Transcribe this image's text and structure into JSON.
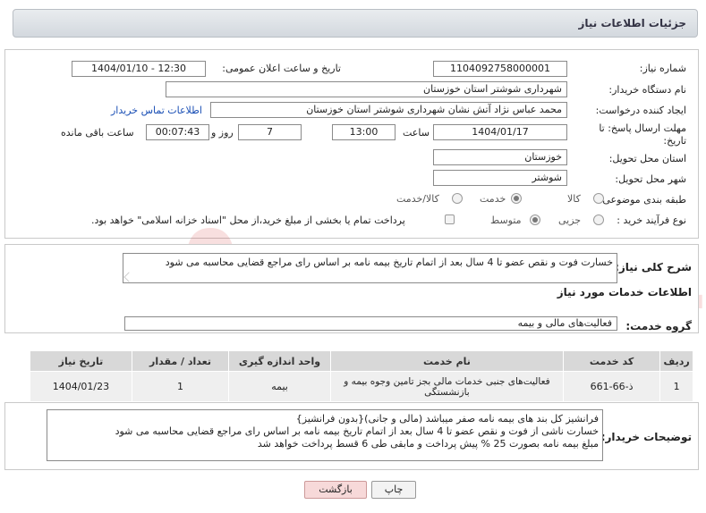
{
  "header": {
    "title": "جزئیات اطلاعات نیاز"
  },
  "form": {
    "need_number_label": "شماره نیاز:",
    "need_number": "1104092758000001",
    "announce_label": "تاریخ و ساعت اعلان عمومی:",
    "announce_value": "1404/01/10 - 12:30",
    "buyer_org_label": "نام دستگاه خریدار:",
    "buyer_org": "شهرداری شوشتر استان خوزستان",
    "creator_label": "ایجاد کننده درخواست:",
    "creator": "محمد عباس نژاد آتش نشان شهرداری شوشتر استان خوزستان",
    "contact_link": "اطلاعات تماس خریدار",
    "deadline_label_1": "مهلت ارسال پاسخ: تا",
    "deadline_label_2": "تاریخ:",
    "deadline_date": "1404/01/17",
    "time_label": "ساعت",
    "deadline_time": "13:00",
    "days_value": "7",
    "days_label": "روز و",
    "remaining_time": "00:07:43",
    "remaining_label": "ساعت باقی مانده",
    "province_label": "استان محل تحویل:",
    "province": "خوزستان",
    "city_label": "شهر محل تحویل:",
    "city": "شوشتر",
    "category_label": "طبقه بندی موضوعی:",
    "category_options": [
      "کالا",
      "خدمت",
      "کالا/خدمت"
    ],
    "category_selected": "خدمت",
    "process_label": "نوع فرآیند خرید :",
    "process_options": [
      "جزیی",
      "متوسط"
    ],
    "process_selected": "متوسط",
    "payment_note": "پرداخت تمام یا بخشی از مبلغ خرید،از محل \"اسناد خزانه اسلامی\" خواهد بود."
  },
  "summary": {
    "label": "شرح کلی نیاز:",
    "text": "خسارت فوت و نقص عضو تا 4 سال بعد از اتمام تاریخ بیمه نامه بر اساس رای مراجع قضایی محاسبه می شود"
  },
  "services": {
    "section_title": "اطلاعات خدمات مورد نیاز",
    "group_label": "گروه خدمت:",
    "group_value": "فعالیت‌های مالی و بیمه",
    "columns": [
      "ردیف",
      "کد خدمت",
      "نام خدمت",
      "واحد اندازه گیری",
      "تعداد / مقدار",
      "تاریخ نیاز"
    ],
    "rows": [
      [
        "1",
        "ذ-66-661",
        "فعالیت‌های جنبی خدمات مالی بجز تامین وجوه بیمه و بازنشستگی",
        "بیمه",
        "1",
        "1404/01/23"
      ]
    ]
  },
  "buyer_notes": {
    "label": "توضیحات خریدار:",
    "lines": [
      "فرانشیز کل بند های بیمه نامه صفر میباشد (مالی و جانی){بدون فرانشیز}",
      "خسارت ناشی از فوت و نقص عضو تا 4 سال بعد از اتمام تاریخ بیمه نامه بر اساس رای مراجع قضایی محاسبه می شود",
      "مبلغ بیمه نامه بصورت 25 % پیش  پرداخت و مابقی طی 6 قسط پرداخت خواهد شد"
    ]
  },
  "actions": {
    "print": "چاپ",
    "back": "بازگشت"
  },
  "watermark": "AriaTender.neT"
}
